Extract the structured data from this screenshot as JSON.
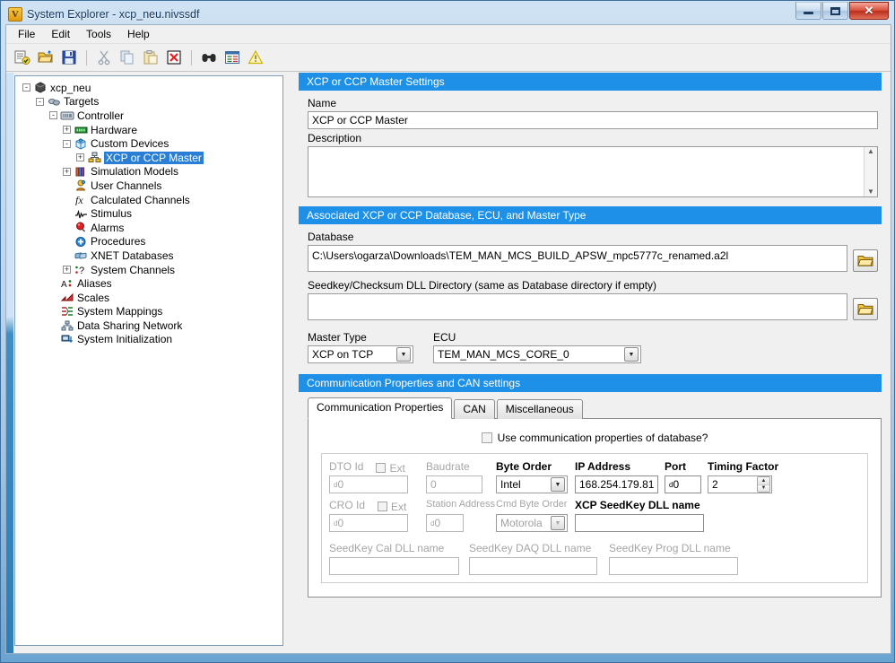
{
  "window": {
    "title": "System Explorer - xcp_neu.nivssdf",
    "app_icon": "V",
    "minimize": "minimize-icon",
    "maximize": "maximize-icon",
    "close": "close-icon"
  },
  "menu": {
    "items": [
      "File",
      "Edit",
      "Tools",
      "Help"
    ]
  },
  "toolbar": {
    "items": [
      {
        "name": "new-icon",
        "glyph": "⚙"
      },
      {
        "name": "open-icon",
        "glyph": "📂"
      },
      {
        "name": "save-icon",
        "glyph": "💾"
      },
      {
        "name": "cut-icon",
        "glyph": "✂"
      },
      {
        "name": "copy-icon",
        "glyph": "⧉"
      },
      {
        "name": "paste-icon",
        "glyph": "📋"
      },
      {
        "name": "delete-icon",
        "glyph": "✕"
      },
      {
        "name": "find-icon",
        "glyph": "🔭"
      },
      {
        "name": "properties-icon",
        "glyph": "≡"
      },
      {
        "name": "warning-icon",
        "glyph": "⚠"
      }
    ]
  },
  "tree": {
    "items": [
      {
        "label": "xcp_neu",
        "depth": 0,
        "expander": "-",
        "icon": "project-icon",
        "selected": false
      },
      {
        "label": "Targets",
        "depth": 1,
        "expander": "-",
        "icon": "targets-icon",
        "selected": false
      },
      {
        "label": "Controller",
        "depth": 2,
        "expander": "-",
        "icon": "controller-icon",
        "selected": false
      },
      {
        "label": "Hardware",
        "depth": 3,
        "expander": "+",
        "icon": "hardware-icon",
        "selected": false
      },
      {
        "label": "Custom Devices",
        "depth": 3,
        "expander": "-",
        "icon": "custom-devices-icon",
        "selected": false
      },
      {
        "label": "XCP or CCP Master",
        "depth": 4,
        "expander": "+",
        "icon": "xcp-master-icon",
        "selected": true
      },
      {
        "label": "Simulation Models",
        "depth": 3,
        "expander": "+",
        "icon": "simulation-icon",
        "selected": false
      },
      {
        "label": "User Channels",
        "depth": 3,
        "expander": "",
        "icon": "user-channels-icon",
        "selected": false
      },
      {
        "label": "Calculated Channels",
        "depth": 3,
        "expander": "",
        "icon": "calculated-icon",
        "selected": false
      },
      {
        "label": "Stimulus",
        "depth": 3,
        "expander": "",
        "icon": "stimulus-icon",
        "selected": false
      },
      {
        "label": "Alarms",
        "depth": 3,
        "expander": "",
        "icon": "alarms-icon",
        "selected": false
      },
      {
        "label": "Procedures",
        "depth": 3,
        "expander": "",
        "icon": "procedures-icon",
        "selected": false
      },
      {
        "label": "XNET Databases",
        "depth": 3,
        "expander": "",
        "icon": "xnet-icon",
        "selected": false
      },
      {
        "label": "System Channels",
        "depth": 3,
        "expander": "+",
        "icon": "system-channels-icon",
        "selected": false
      },
      {
        "label": "Aliases",
        "depth": 2,
        "expander": "",
        "icon": "aliases-icon",
        "selected": false
      },
      {
        "label": "Scales",
        "depth": 2,
        "expander": "",
        "icon": "scales-icon",
        "selected": false
      },
      {
        "label": "System Mappings",
        "depth": 2,
        "expander": "",
        "icon": "mappings-icon",
        "selected": false
      },
      {
        "label": "Data Sharing Network",
        "depth": 2,
        "expander": "",
        "icon": "data-sharing-icon",
        "selected": false
      },
      {
        "label": "System Initialization",
        "depth": 2,
        "expander": "",
        "icon": "system-init-icon",
        "selected": false
      }
    ]
  },
  "master_settings": {
    "header": "XCP or CCP Master Settings",
    "name_label": "Name",
    "name_value": "XCP or CCP Master",
    "description_label": "Description",
    "description_value": ""
  },
  "database_section": {
    "header": "Associated XCP or CCP Database, ECU, and Master Type",
    "database_label": "Database",
    "database_value": "C:\\Users\\ogarza\\Downloads\\TEM_MAN_MCS_BUILD_APSW_mpc5777c_renamed.a2l",
    "seedkey_label": "Seedkey/Checksum DLL Directory (same as Database directory if empty)",
    "seedkey_value": "",
    "master_type_label": "Master Type",
    "master_type_value": "XCP on TCP",
    "ecu_label": "ECU",
    "ecu_value": "TEM_MAN_MCS_CORE_0"
  },
  "comm_section": {
    "header": "Communication Properties and CAN settings",
    "tabs": [
      {
        "label": "Communication Properties",
        "active": true
      },
      {
        "label": "CAN",
        "active": false
      },
      {
        "label": "Miscellaneous",
        "active": false
      }
    ],
    "use_db_checkbox_label": "Use communication properties of database?",
    "use_db_checked": false,
    "fields": {
      "dto_id_label": "DTO Id",
      "dto_id_value": "d0",
      "dto_ext_label": "Ext",
      "dto_ext_checked": false,
      "baudrate_label": "Baudrate",
      "baudrate_value": "0",
      "byte_order_label": "Byte Order",
      "byte_order_value": "Intel",
      "ip_address_label": "IP Address",
      "ip_address_value": "168.254.179.81",
      "port_label": "Port",
      "port_value": "d0",
      "timing_factor_label": "Timing Factor",
      "timing_factor_value": "2",
      "cro_id_label": "CRO Id",
      "cro_id_value": "d0",
      "cro_ext_label": "Ext",
      "cro_ext_checked": false,
      "station_address_label": "Station Address",
      "station_address_value": "d0",
      "cmd_byte_order_label": "Cmd Byte Order",
      "cmd_byte_order_value": "Motorola",
      "xcp_seedkey_label": "XCP SeedKey DLL name",
      "xcp_seedkey_value": "",
      "seedkey_cal_label": "SeedKey Cal DLL name",
      "seedkey_cal_value": "",
      "seedkey_daq_label": "SeedKey DAQ DLL name",
      "seedkey_daq_value": "",
      "seedkey_prog_label": "SeedKey Prog DLL name",
      "seedkey_prog_value": ""
    }
  },
  "colors": {
    "section_header": "#1e90e8",
    "selection": "#2a7fd4",
    "window_bg": "#f0f0f0"
  }
}
